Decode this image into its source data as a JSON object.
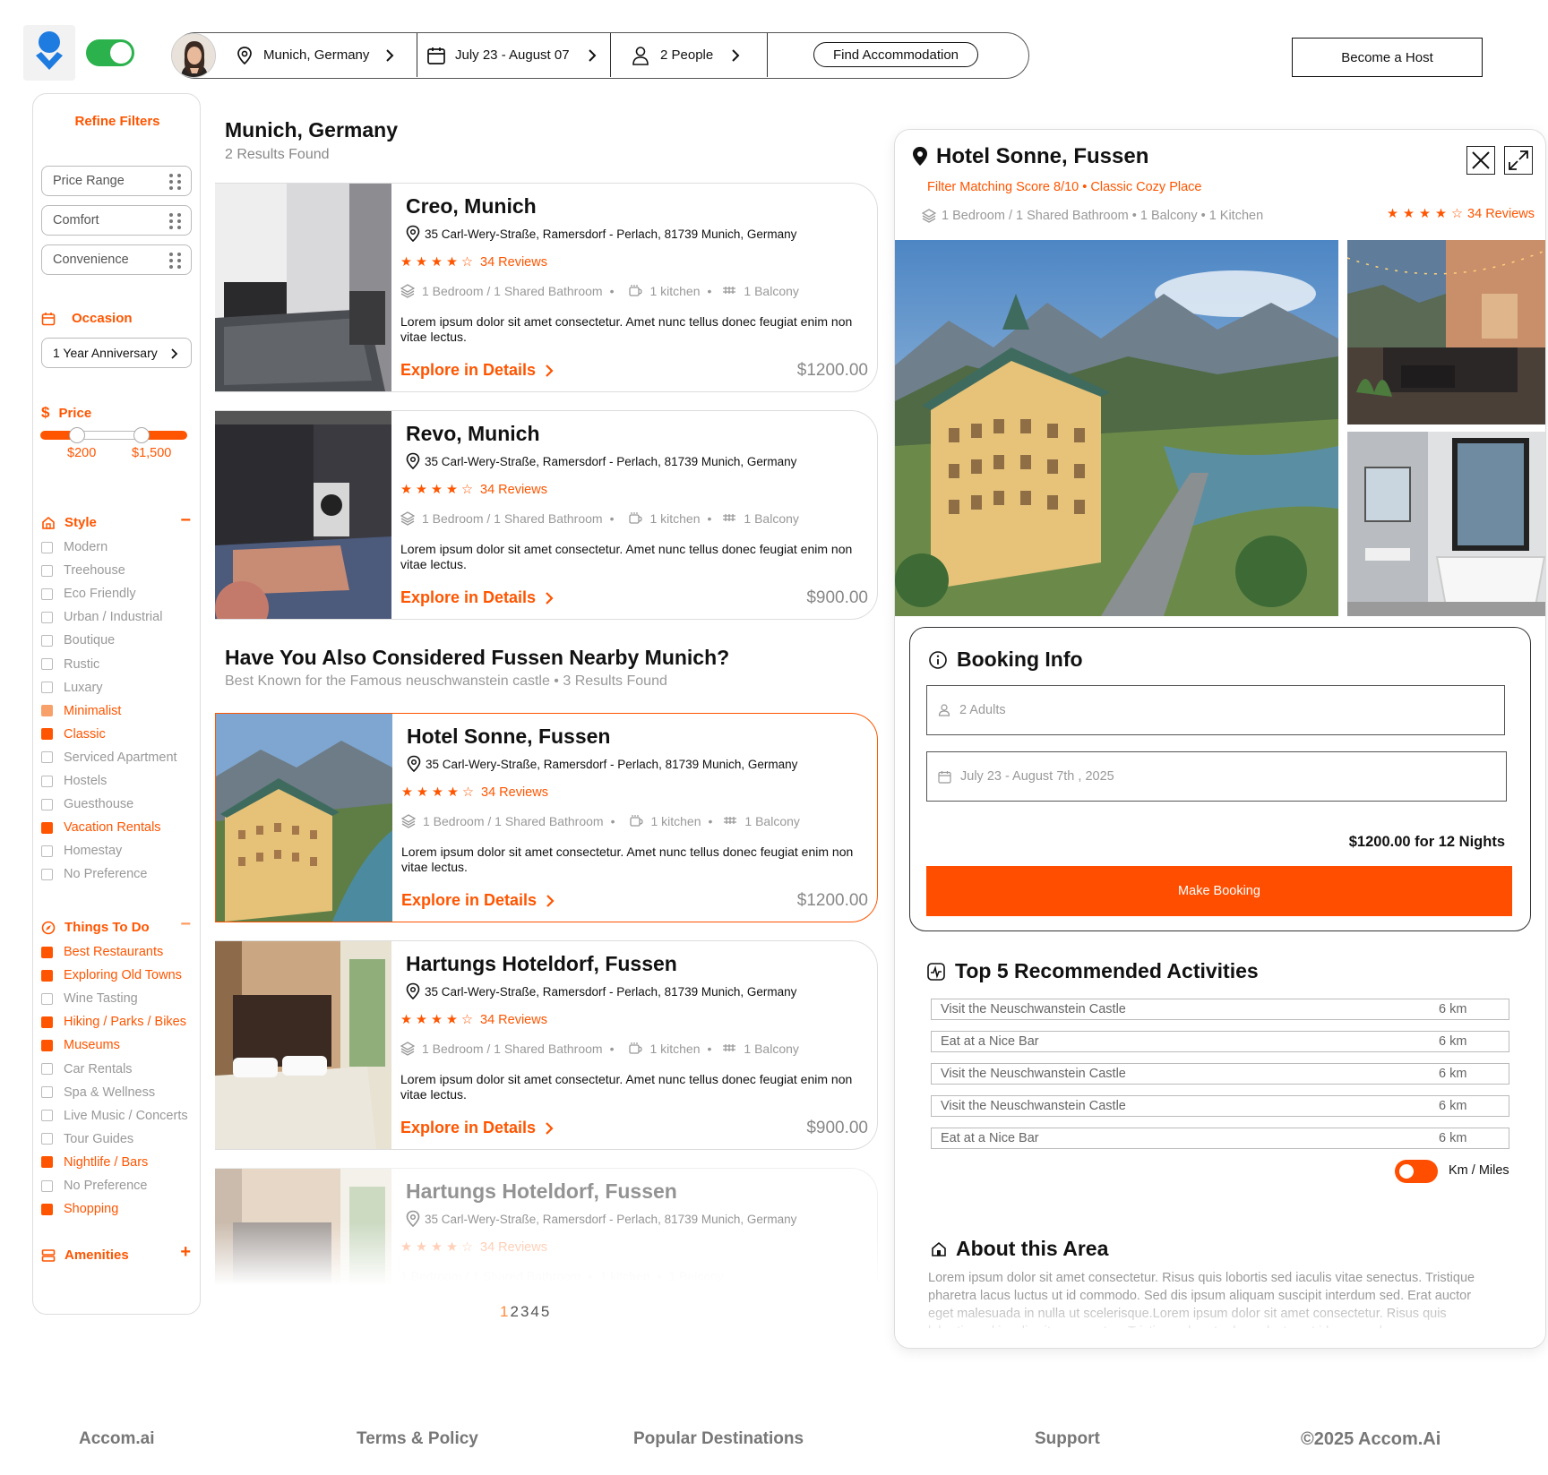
{
  "header": {
    "location": "Munich, Germany",
    "dates": "July 23 - August 07",
    "people": "2 People",
    "find_button": "Find Accommodation",
    "host_button": "Become a Host"
  },
  "sidebar": {
    "title": "Refine Filters",
    "pills": [
      "Price Range",
      "Comfort",
      "Convenience"
    ],
    "occasion_label": "Occasion",
    "occasion_value": "1 Year Anniversary",
    "price_label": "Price",
    "price_min": "$200",
    "price_max": "$1,500",
    "style_label": "Style",
    "style_items": [
      {
        "label": "Modern",
        "state": "off"
      },
      {
        "label": "Treehouse",
        "state": "off"
      },
      {
        "label": "Eco Friendly",
        "state": "off"
      },
      {
        "label": "Urban / Industrial",
        "state": "off"
      },
      {
        "label": "Boutique",
        "state": "off"
      },
      {
        "label": "Rustic",
        "state": "off"
      },
      {
        "label": "Luxary",
        "state": "off"
      },
      {
        "label": "Minimalist",
        "state": "half"
      },
      {
        "label": "Classic",
        "state": "on"
      },
      {
        "label": "Serviced Apartment",
        "state": "off"
      },
      {
        "label": "Hostels",
        "state": "off"
      },
      {
        "label": "Guesthouse",
        "state": "off"
      },
      {
        "label": "Vacation Rentals",
        "state": "on"
      },
      {
        "label": "Homestay",
        "state": "off"
      },
      {
        "label": "No Preference",
        "state": "off"
      }
    ],
    "todo_label": "Things To Do",
    "todo_items": [
      {
        "label": "Best Restaurants",
        "state": "on"
      },
      {
        "label": "Exploring Old Towns",
        "state": "on"
      },
      {
        "label": "Wine Tasting",
        "state": "off"
      },
      {
        "label": "Hiking  / Parks / Bikes",
        "state": "on"
      },
      {
        "label": "Museums",
        "state": "on"
      },
      {
        "label": "Car Rentals",
        "state": "off"
      },
      {
        "label": "Spa &  Wellness",
        "state": "off"
      },
      {
        "label": "Live Music / Concerts",
        "state": "off"
      },
      {
        "label": "Tour Guides",
        "state": "off"
      },
      {
        "label": "Nightlife / Bars",
        "state": "on"
      },
      {
        "label": "No Preference",
        "state": "off"
      },
      {
        "label": "Shopping",
        "state": "on"
      }
    ],
    "amenities_label": "Amenities"
  },
  "results": {
    "title": "Munich, Germany",
    "subtitle": "2 Results Found",
    "considered_title": "Have You Also Considered Fussen Nearby Munich?",
    "considered_subtitle": "Best Known for the Famous neuschwanstein castle • 3 Results Found",
    "cards": [
      {
        "name": "Creo, Munich",
        "address": "35 Carl-Wery-Straße, Ramersdorf - Perlach, 81739 Munich, Germany",
        "reviews": "34 Reviews",
        "rooms": "1 Bedroom / 1 Shared Bathroom",
        "kitchen": "1 kitchen",
        "balcony": "1 Balcony",
        "desc": "Lorem ipsum dolor sit amet consectetur. Amet nunc tellus donec feugiat enim non vitae lectus.",
        "explore": "Explore in Details",
        "price": "$1200.00"
      },
      {
        "name": "Revo, Munich",
        "address": "35 Carl-Wery-Straße, Ramersdorf - Perlach, 81739 Munich, Germany",
        "reviews": "34 Reviews",
        "rooms": "1 Bedroom / 1 Shared Bathroom",
        "kitchen": "1 kitchen",
        "balcony": "1 Balcony",
        "desc": "Lorem ipsum dolor sit amet consectetur. Amet nunc tellus donec feugiat enim non vitae lectus.",
        "explore": "Explore in Details",
        "price": "$900.00"
      },
      {
        "name": "Hotel Sonne, Fussen",
        "address": "35 Carl-Wery-Straße, Ramersdorf - Perlach, 81739 Munich, Germany",
        "reviews": "34 Reviews",
        "rooms": "1 Bedroom / 1 Shared Bathroom",
        "kitchen": "1 kitchen",
        "balcony": "1 Balcony",
        "desc": "Lorem ipsum dolor sit amet consectetur. Amet nunc tellus donec feugiat enim non vitae lectus.",
        "explore": "Explore in Details",
        "price": "$1200.00"
      },
      {
        "name": "Hartungs Hoteldorf, Fussen",
        "address": "35 Carl-Wery-Straße, Ramersdorf - Perlach, 81739 Munich, Germany",
        "reviews": "34 Reviews",
        "rooms": "1 Bedroom / 1 Shared Bathroom",
        "kitchen": "1 kitchen",
        "balcony": "1 Balcony",
        "desc": "Lorem ipsum dolor sit amet consectetur. Amet nunc tellus donec feugiat enim non vitae lectus.",
        "explore": "Explore in Details",
        "price": "$900.00"
      },
      {
        "name": "Hartungs Hoteldorf, Fussen",
        "address": "35 Carl-Wery-Straße, Ramersdorf - Perlach, 81739 Munich, Germany",
        "reviews": "34 Reviews",
        "rooms": "1 Bedroom / 1 Shared Bathroom",
        "kitchen": "1 kitchen",
        "balcony": "1 Balcony",
        "desc": "",
        "explore": "",
        "price": ""
      }
    ],
    "pages": [
      "1",
      "2",
      "3",
      "4",
      "5"
    ]
  },
  "detail": {
    "name": "Hotel Sonne, Fussen",
    "score": "Filter Matching Score 8/10 • Classic Cozy Place",
    "features": "1 Bedroom / 1 Shared Bathroom  • 1 Balcony • 1 Kitchen",
    "reviews": "34 Reviews",
    "booking": {
      "title": "Booking Info",
      "adults": "2 Adults",
      "dates": "July 23 - August 7th , 2025",
      "total": "$1200.00 for 12 Nights",
      "button": "Make Booking"
    },
    "activities_title": "Top 5 Recommended Activities",
    "activities": [
      {
        "name": "Visit the Neuschwanstein Castle",
        "distance": "6 km"
      },
      {
        "name": "Eat at a Nice Bar",
        "distance": "6 km"
      },
      {
        "name": "Visit the Neuschwanstein Castle",
        "distance": "6 km"
      },
      {
        "name": "Visit the Neuschwanstein Castle",
        "distance": "6 km"
      },
      {
        "name": "Eat at a Nice Bar",
        "distance": "6 km"
      }
    ],
    "unit_label": "Km / Miles",
    "about_title": "About this Area",
    "about_text": "Lorem ipsum dolor sit amet consectetur. Risus quis lobortis sed iaculis vitae senectus. Tristique pharetra lacus luctus ut id commodo. Sed dis ipsum aliquam suscipit interdum sed. Erat auctor eget malesuada in nulla ut scelerisque.Lorem ipsum dolor sit amet consectetur. Risus quis lobortis sed iaculis vitae senectus. Tristique pharetra lacus luctus ut id commodo."
  },
  "footer": {
    "brand": "Accom.ai",
    "terms": "Terms & Policy",
    "destinations": "Popular Destinations",
    "support": "Support",
    "copyright": "©2025 Accom.Ai"
  },
  "colors": {
    "accent": "#ff5500",
    "toggle_green": "#2bb24c",
    "logo_blue": "#1e7be0"
  }
}
